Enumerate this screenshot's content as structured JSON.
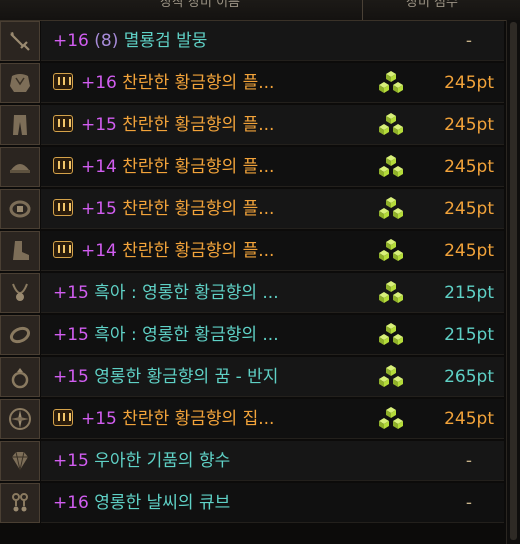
{
  "header": {
    "col_item": "장착 장비 이름",
    "col_points": "장비 점수"
  },
  "rows": [
    {
      "icon": "sword-icon",
      "level": "+16",
      "sub": "(8)",
      "name": "멸룡검 발뭉",
      "name_color": "teal",
      "badge": false,
      "cube": false,
      "points": "-",
      "points_color": "dash"
    },
    {
      "icon": "shoulder-armor-icon",
      "level": "+16",
      "name": "찬란한 황금향의 플...",
      "name_color": "orange",
      "badge": true,
      "cube": true,
      "points": "245pt",
      "points_color": "orange"
    },
    {
      "icon": "pants-icon",
      "level": "+15",
      "name": "찬란한 황금향의 플...",
      "name_color": "orange",
      "badge": true,
      "cube": true,
      "points": "245pt",
      "points_color": "orange"
    },
    {
      "icon": "helmet-icon",
      "level": "+14",
      "name": "찬란한 황금향의 플...",
      "name_color": "orange",
      "badge": true,
      "cube": true,
      "points": "245pt",
      "points_color": "orange"
    },
    {
      "icon": "belt-icon",
      "level": "+15",
      "name": "찬란한 황금향의 플...",
      "name_color": "orange",
      "badge": true,
      "cube": true,
      "points": "245pt",
      "points_color": "orange"
    },
    {
      "icon": "boots-icon",
      "level": "+14",
      "name": "찬란한 황금향의 플...",
      "name_color": "orange",
      "badge": true,
      "cube": true,
      "points": "245pt",
      "points_color": "orange"
    },
    {
      "icon": "necklace-icon",
      "level": "+15",
      "name": "흑아 : 영롱한 황금향의 ...",
      "name_color": "teal",
      "badge": false,
      "cube": true,
      "points": "215pt",
      "points_color": "teal"
    },
    {
      "icon": "bracelet-icon",
      "level": "+15",
      "name": "흑아 : 영롱한 황금향의 ...",
      "name_color": "teal",
      "badge": false,
      "cube": true,
      "points": "215pt",
      "points_color": "teal"
    },
    {
      "icon": "ring-icon",
      "level": "+15",
      "name": "영롱한 황금향의 꿈 - 반지",
      "name_color": "teal",
      "badge": false,
      "cube": true,
      "points": "265pt",
      "points_color": "teal"
    },
    {
      "icon": "compass-icon",
      "level": "+15",
      "name": "찬란한 황금향의 집...",
      "name_color": "orange",
      "badge": true,
      "cube": true,
      "points": "245pt",
      "points_color": "orange"
    },
    {
      "icon": "gem-icon",
      "level": "+15",
      "name": "우아한 기품의 향수",
      "name_color": "teal",
      "badge": false,
      "cube": false,
      "points": "-",
      "points_color": "dash"
    },
    {
      "icon": "earring-icon",
      "level": "+16",
      "name": "영롱한 날씨의 큐브",
      "name_color": "teal",
      "badge": false,
      "cube": false,
      "points": "-",
      "points_color": "dash"
    }
  ],
  "colors": {
    "level": "#d15df0",
    "orange": "#f2a33a",
    "teal": "#5fd1c6",
    "cube": "#b5dc3a"
  }
}
